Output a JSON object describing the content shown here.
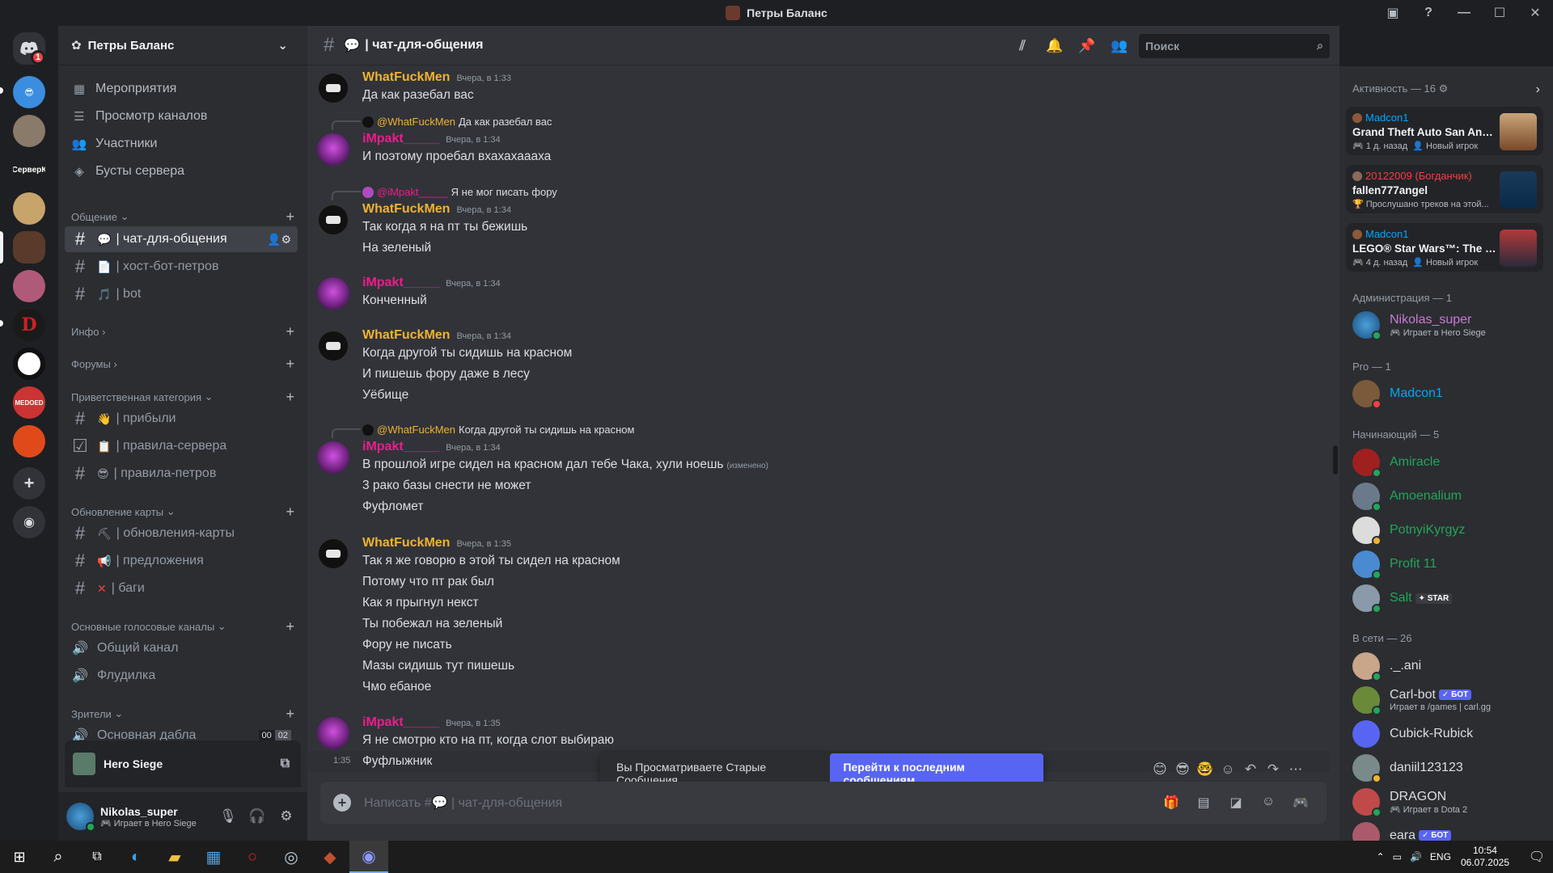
{
  "window": {
    "title": "Петры Баланс"
  },
  "servers": [
    {
      "label": ""
    },
    {
      "label": ""
    },
    {
      "label": "СерверК"
    },
    {
      "label": ""
    },
    {
      "label": ""
    },
    {
      "label": ""
    },
    {
      "label": "D"
    },
    {
      "label": ""
    },
    {
      "label": "MEDOED"
    },
    {
      "label": ""
    }
  ],
  "server_badge": "1",
  "sidebar": {
    "guild_name": "Петры Баланс",
    "nav": [
      {
        "label": "Мероприятия"
      },
      {
        "label": "Просмотр каналов"
      },
      {
        "label": "Участники"
      },
      {
        "label": "Бусты сервера"
      }
    ],
    "categories": {
      "talk": "Общение",
      "info": "Инфо",
      "forums": "Форумы",
      "welcome": "Приветственная категория",
      "map": "Обновление карты",
      "voice": "Основные голосовые каналы",
      "viewers": "Зрители"
    },
    "channels": {
      "chat": "| чат-для-общения",
      "host": "| хост-бот-петров",
      "bot": "| bot",
      "arrivals": "| прибыли",
      "rules_server": "| правила-сервера",
      "rules_petrov": "| правила-петров",
      "map_updates": "| обновления-карты",
      "suggestions": "| предложения",
      "bugs": "| баги",
      "general_voice": "Общий канал",
      "flood": "Флудилка",
      "main_dabla": "Основная дабла"
    },
    "dabla_counts": {
      "a": "00",
      "b": "02"
    },
    "voice_activity": "Hero Siege",
    "user": {
      "name": "Nikolas_super",
      "status": "Играет в Hero Siege"
    }
  },
  "header": {
    "channel": "| чат-для-общения",
    "search_placeholder": "Поиск"
  },
  "messages": {
    "m1": {
      "author": "WhatFuckMen",
      "ts": "Вчера, в 1:33",
      "lines": [
        "Да как разебал вас"
      ]
    },
    "m2": {
      "reply_to": "@WhatFuckMen",
      "reply_text": "Да как разебал вас",
      "author": "iMpakt_____",
      "ts": "Вчера, в 1:34",
      "lines": [
        "И  поэтому проебал вхахахаааха"
      ]
    },
    "m3": {
      "reply_to": "@iMpakt_____",
      "reply_text": "Я не мог писать фору",
      "author": "WhatFuckMen",
      "ts": "Вчера, в 1:34",
      "lines": [
        "Так когда я на пт ты бежишь",
        "На зеленый"
      ]
    },
    "m4": {
      "author": "iMpakt_____",
      "ts": "Вчера, в 1:34",
      "lines": [
        "Конченный"
      ]
    },
    "m5": {
      "author": "WhatFuckMen",
      "ts": "Вчера, в 1:34",
      "lines": [
        "Когда другой ты сидишь на красном",
        "И пишешь фору даже в лесу",
        "Уёбище"
      ]
    },
    "m6": {
      "reply_to": "@WhatFuckMen",
      "reply_text": "Когда другой ты сидишь на красном",
      "author": "iMpakt_____",
      "ts": "Вчера, в 1:34",
      "lines": [
        "В прошлой игре сидел на красном дал тебе Чака, хули ноешь",
        "3 рако базы снести не может",
        "Фуфломет"
      ],
      "edited": "(изменено)"
    },
    "m7": {
      "author": "WhatFuckMen",
      "ts": "Вчера, в 1:35",
      "lines": [
        "Так я же говорю в этой ты сидел на красном",
        "Потому что пт рак был",
        "Как я прыгнул некст",
        "Ты побежал на зеленый",
        "Фору не писать",
        "Мазы сидишь тут пишешь",
        "Чмо ебаное"
      ]
    },
    "m8": {
      "author": "iMpakt_____",
      "ts": "Вчера, в 1:35",
      "lines": [
        "Я не смотрю кто на пт, когда слот выбираю"
      ]
    },
    "m9": {
      "time": "1:35",
      "lines": [
        "Фуфлыжник"
      ]
    }
  },
  "banner": {
    "text": "Вы Просматриваете Старые Сообщения",
    "button": "Перейти к последним сообщениям"
  },
  "composer": {
    "placeholder": "Написать #💬 | чат-для-общения"
  },
  "members": {
    "activity_header": "Активность — 16",
    "activities": [
      {
        "user": "Madcon1",
        "game": "Grand Theft Auto San Andr...",
        "time": "1 д. назад",
        "extra": "Новый игрок"
      },
      {
        "user": "20122009 (Богданчик)",
        "game": "fallen777angel",
        "time": "Прослушано треков на этой...",
        "extra": ""
      },
      {
        "user": "Madcon1",
        "game": "LEGO® Star Wars™: The Sk...",
        "time": "4 д. назад",
        "extra": "Новый игрок"
      }
    ],
    "groups": {
      "admin": "Администрация — 1",
      "pro": "Pro — 1",
      "beginner": "Начинающий — 5",
      "online": "В сети — 26"
    },
    "list": {
      "admin1": {
        "name": "Nikolas_super",
        "sub": "Играет в Hero Siege"
      },
      "pro1": {
        "name": "Madcon1"
      },
      "b1": {
        "name": "Amiracle"
      },
      "b2": {
        "name": "Amoenalium"
      },
      "b3": {
        "name": "PotnyiKyrgyz"
      },
      "b4": {
        "name": "Profit 11"
      },
      "b5": {
        "name": "Salt",
        "badge": "STAR"
      },
      "o1": {
        "name": "._.ani"
      },
      "o2": {
        "name": "Carl-bot",
        "badge": "БОТ",
        "sub": "Играет в /games | carl.gg"
      },
      "o3": {
        "name": "Cubick-Rubick"
      },
      "o4": {
        "name": "daniil123123"
      },
      "o5": {
        "name": "DRAGON",
        "sub": "Играет в Dota 2"
      },
      "o6": {
        "name": "eara",
        "badge": "БОТ"
      }
    }
  },
  "taskbar": {
    "lang": "ENG",
    "time": "10:54",
    "date": "06.07.2025"
  },
  "colors": {
    "accent": "#5865f2",
    "author_w": "#f0b232",
    "author_i": "#e91e8c",
    "bg": "#313338"
  }
}
